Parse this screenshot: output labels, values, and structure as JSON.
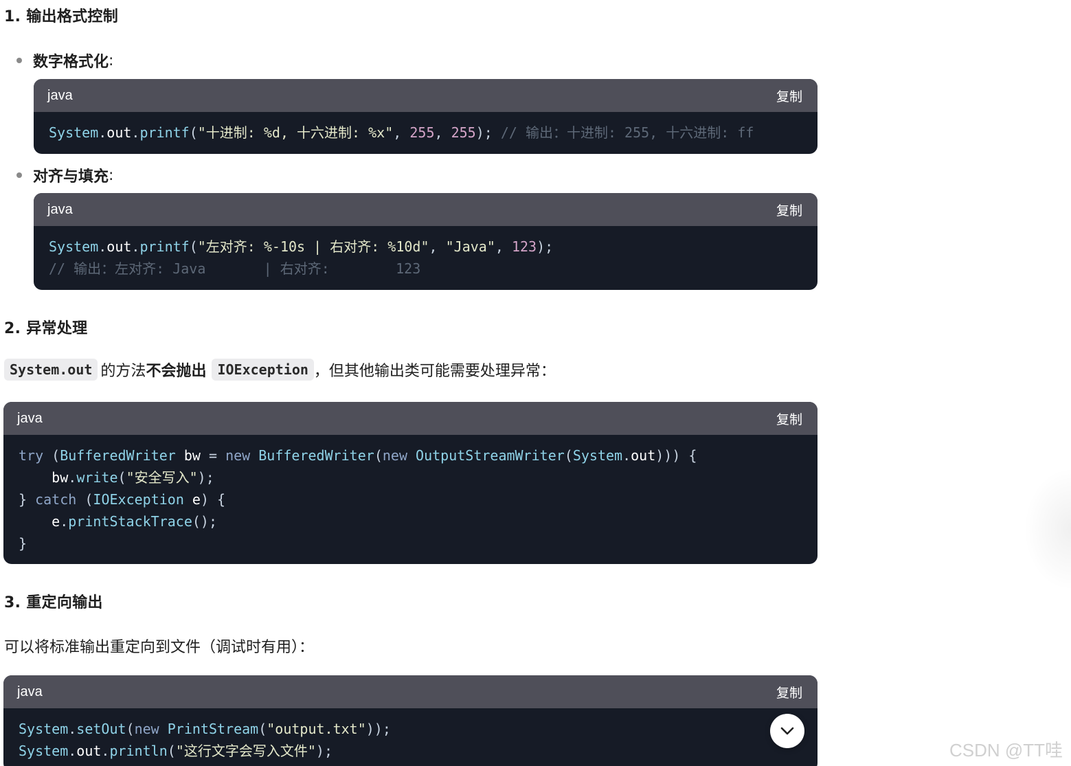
{
  "sections": {
    "s1": {
      "heading": "1. 输出格式控制"
    },
    "s2": {
      "heading": "2. 异常处理"
    },
    "s3": {
      "heading": "3. 重定向输出"
    }
  },
  "bullets": {
    "b1": {
      "label": "数字格式化",
      "suffix": ":"
    },
    "b2": {
      "label": "对齐与填充",
      "suffix": ":"
    }
  },
  "paragraphs": {
    "p_exception": {
      "code1": "System.out",
      "text1": " 的方法",
      "bold": "不会抛出",
      "code2": "IOException",
      "text2": "，但其他输出类可能需要处理异常："
    },
    "p_redirect": {
      "text": "可以将标准输出重定向到文件（调试时有用）："
    }
  },
  "code_blocks": {
    "lang": "java",
    "copy_label": "复制",
    "block1": {
      "lines": [
        [
          {
            "t": "System",
            "c": "cls"
          },
          {
            "t": ".",
            "c": "pun"
          },
          {
            "t": "out",
            "c": "id"
          },
          {
            "t": ".",
            "c": "pun"
          },
          {
            "t": "printf",
            "c": "fn"
          },
          {
            "t": "(",
            "c": "pun"
          },
          {
            "t": "\"十进制: %d, 十六进制: %x\"",
            "c": "str"
          },
          {
            "t": ", ",
            "c": "pun"
          },
          {
            "t": "255",
            "c": "num"
          },
          {
            "t": ", ",
            "c": "pun"
          },
          {
            "t": "255",
            "c": "num"
          },
          {
            "t": "); ",
            "c": "pun"
          },
          {
            "t": "// 输出：十进制: 255, 十六进制: ff",
            "c": "com"
          }
        ]
      ]
    },
    "block2": {
      "lines": [
        [
          {
            "t": "System",
            "c": "cls"
          },
          {
            "t": ".",
            "c": "pun"
          },
          {
            "t": "out",
            "c": "id"
          },
          {
            "t": ".",
            "c": "pun"
          },
          {
            "t": "printf",
            "c": "fn"
          },
          {
            "t": "(",
            "c": "pun"
          },
          {
            "t": "\"左对齐: %-10s | 右对齐: %10d\"",
            "c": "str"
          },
          {
            "t": ", ",
            "c": "pun"
          },
          {
            "t": "\"Java\"",
            "c": "str"
          },
          {
            "t": ", ",
            "c": "pun"
          },
          {
            "t": "123",
            "c": "num"
          },
          {
            "t": ");",
            "c": "pun"
          }
        ],
        [
          {
            "t": "// 输出：左对齐: Java       | 右对齐:        123",
            "c": "com"
          }
        ]
      ]
    },
    "block3": {
      "lines": [
        [
          {
            "t": "try",
            "c": "kw"
          },
          {
            "t": " (",
            "c": "pun"
          },
          {
            "t": "BufferedWriter",
            "c": "cls"
          },
          {
            "t": " ",
            "c": "pun"
          },
          {
            "t": "bw",
            "c": "id"
          },
          {
            "t": " = ",
            "c": "pun"
          },
          {
            "t": "new",
            "c": "kw"
          },
          {
            "t": " ",
            "c": "pun"
          },
          {
            "t": "BufferedWriter",
            "c": "cls"
          },
          {
            "t": "(",
            "c": "pun"
          },
          {
            "t": "new",
            "c": "kw"
          },
          {
            "t": " ",
            "c": "pun"
          },
          {
            "t": "OutputStreamWriter",
            "c": "cls"
          },
          {
            "t": "(",
            "c": "pun"
          },
          {
            "t": "System",
            "c": "cls"
          },
          {
            "t": ".",
            "c": "pun"
          },
          {
            "t": "out",
            "c": "id"
          },
          {
            "t": "))) {",
            "c": "pun"
          }
        ],
        [
          {
            "t": "    ",
            "c": "pun"
          },
          {
            "t": "bw",
            "c": "id"
          },
          {
            "t": ".",
            "c": "pun"
          },
          {
            "t": "write",
            "c": "fn"
          },
          {
            "t": "(",
            "c": "pun"
          },
          {
            "t": "\"安全写入\"",
            "c": "str"
          },
          {
            "t": ");",
            "c": "pun"
          }
        ],
        [
          {
            "t": "} ",
            "c": "pun"
          },
          {
            "t": "catch",
            "c": "kw"
          },
          {
            "t": " (",
            "c": "pun"
          },
          {
            "t": "IOException",
            "c": "cls"
          },
          {
            "t": " ",
            "c": "pun"
          },
          {
            "t": "e",
            "c": "id"
          },
          {
            "t": ") {",
            "c": "pun"
          }
        ],
        [
          {
            "t": "    ",
            "c": "pun"
          },
          {
            "t": "e",
            "c": "id"
          },
          {
            "t": ".",
            "c": "pun"
          },
          {
            "t": "printStackTrace",
            "c": "fn"
          },
          {
            "t": "();",
            "c": "pun"
          }
        ],
        [
          {
            "t": "}",
            "c": "pun"
          }
        ]
      ]
    },
    "block4": {
      "lines": [
        [
          {
            "t": "System",
            "c": "cls"
          },
          {
            "t": ".",
            "c": "pun"
          },
          {
            "t": "setOut",
            "c": "fn"
          },
          {
            "t": "(",
            "c": "pun"
          },
          {
            "t": "new",
            "c": "kw"
          },
          {
            "t": " ",
            "c": "pun"
          },
          {
            "t": "PrintStream",
            "c": "cls"
          },
          {
            "t": "(",
            "c": "pun"
          },
          {
            "t": "\"output.txt\"",
            "c": "str"
          },
          {
            "t": "));",
            "c": "pun"
          }
        ],
        [
          {
            "t": "System",
            "c": "cls"
          },
          {
            "t": ".",
            "c": "pun"
          },
          {
            "t": "out",
            "c": "id"
          },
          {
            "t": ".",
            "c": "pun"
          },
          {
            "t": "println",
            "c": "fn"
          },
          {
            "t": "(",
            "c": "pun"
          },
          {
            "t": "\"这行文字会写入文件\"",
            "c": "str"
          },
          {
            "t": ");",
            "c": "pun"
          }
        ]
      ]
    }
  },
  "watermark": "CSDN @TT哇",
  "icons": {
    "scroll_down": "chevron-down-icon"
  }
}
